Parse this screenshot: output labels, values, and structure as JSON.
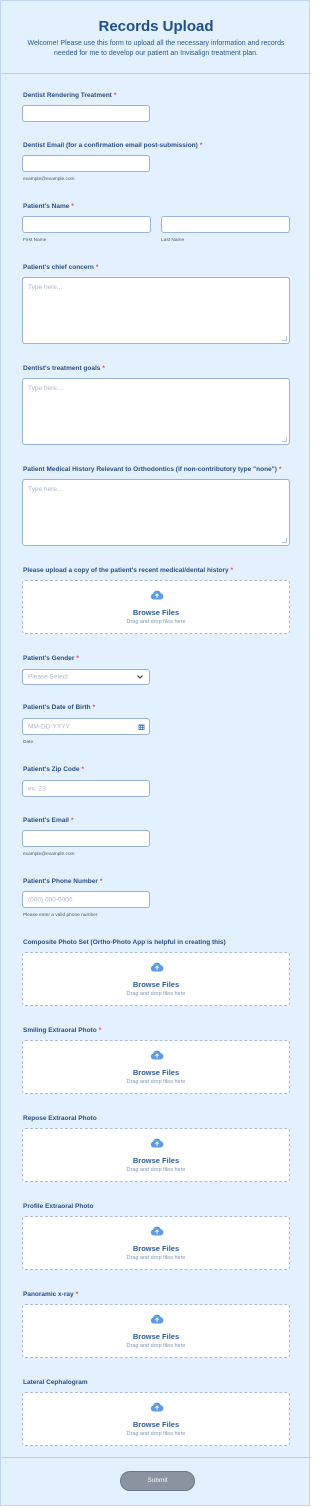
{
  "header": {
    "title": "Records Upload",
    "subtitle": "Welcome! Please use this form to upload all the necessary information and records needed for me to develop our patient an Invisalign treatment plan."
  },
  "fields": {
    "dentist_rendering": {
      "label": "Dentist Rendering Treatment",
      "required": "*"
    },
    "dentist_email": {
      "label": "Dentist Email (for a confirmation email post-submission)",
      "required": "*",
      "sublabel": "example@example.com"
    },
    "patient_name": {
      "label": "Patient's Name",
      "required": "*",
      "first_sublabel": "First Name",
      "last_sublabel": "Last Name"
    },
    "chief_concern": {
      "label": "Patient's chief concern",
      "required": "*",
      "placeholder": "Type here..."
    },
    "treatment_goals": {
      "label": "Dentist's treatment goals",
      "required": "*",
      "placeholder": "Type here..."
    },
    "medical_history": {
      "label": "Patient Medical History Relevant to Orthodontics (if non-contributory type \"none\")",
      "required": "*",
      "placeholder": "Type here..."
    },
    "history_upload": {
      "label": "Please upload a copy of the patient's recent medical/dental history",
      "required": "*"
    },
    "gender": {
      "label": "Patient's Gender",
      "required": "*",
      "selected": "Please Select"
    },
    "dob": {
      "label": "Patient's Date of Birth",
      "required": "*",
      "placeholder": "MM-DD-YYYY",
      "sublabel": "Date"
    },
    "zip": {
      "label": "Patient's Zip Code",
      "required": "*",
      "placeholder": "ex: 23"
    },
    "email": {
      "label": "Patient's Email",
      "required": "*",
      "sublabel": "example@example.com"
    },
    "phone": {
      "label": "Patient's Phone Number",
      "required": "*",
      "placeholder": "(000) 000-0000",
      "sublabel": "Please enter a valid phone number."
    },
    "composite_photo": {
      "label": "Composite Photo Set (Ortho-Photo App is helpful in creating this)"
    },
    "smiling_photo": {
      "label": "Smiling Extraoral Photo",
      "required": "*"
    },
    "repose_photo": {
      "label": "Repose Extraoral Photo"
    },
    "profile_photo": {
      "label": "Profile Extraoral Photo"
    },
    "panoramic": {
      "label": "Panoramic x-ray",
      "required": "*"
    },
    "ceph": {
      "label": "Lateral Cephalogram"
    }
  },
  "upload": {
    "browse_label": "Browse Files",
    "drag_label": "Drag and drop files here"
  },
  "footer": {
    "submit_label": "Submit"
  },
  "colors": {
    "background": "#e3f0fd",
    "heading": "#1f4e8c",
    "required": "#e5484d",
    "upload_icon": "#5b9be8",
    "submit": "#8a93a0"
  },
  "icons": {
    "upload": "cloud-upload-icon",
    "select": "chevron-down-icon",
    "date": "calendar-icon"
  }
}
